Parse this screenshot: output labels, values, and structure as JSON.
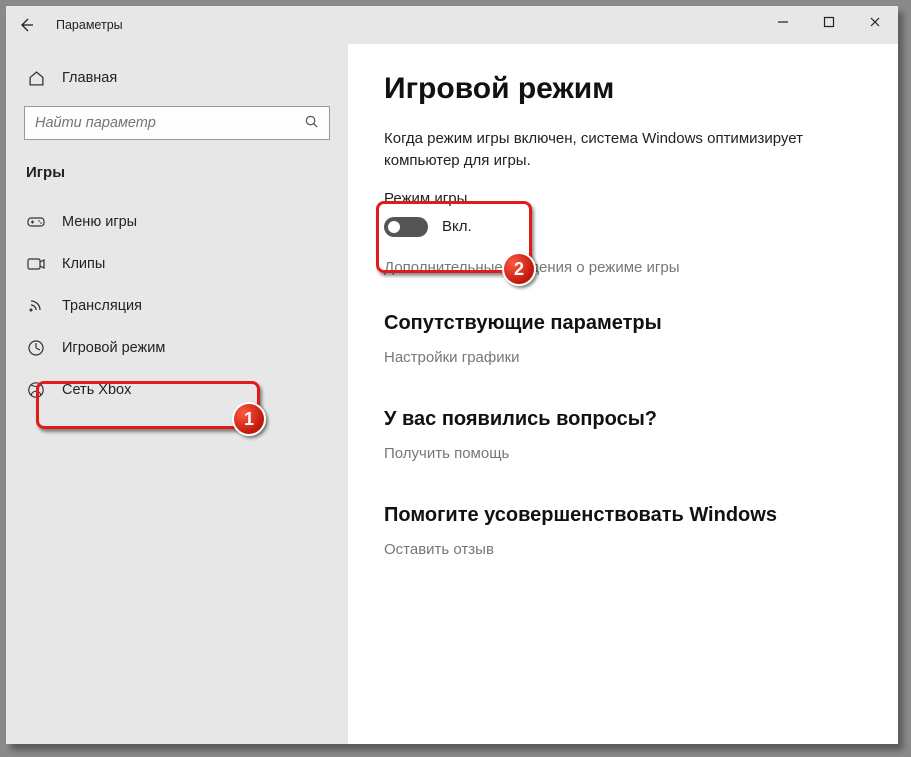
{
  "window": {
    "title": "Параметры"
  },
  "sidebar": {
    "home": "Главная",
    "search_placeholder": "Найти параметр",
    "category": "Игры",
    "items": [
      {
        "label": "Меню игры"
      },
      {
        "label": "Клипы"
      },
      {
        "label": "Трансляция"
      },
      {
        "label": "Игровой режим"
      },
      {
        "label": "Сеть Xbox"
      }
    ]
  },
  "content": {
    "title": "Игровой режим",
    "description": "Когда режим игры включен, система Windows оптимизирует компьютер для игры.",
    "toggle_label": "Режим игры",
    "toggle_state": "Вкл.",
    "more_info": "Дополнительные сведения о режиме игры",
    "related_heading": "Сопутствующие параметры",
    "related_link": "Настройки графики",
    "help_heading": "У вас появились вопросы?",
    "help_link": "Получить помощь",
    "feedback_heading": "Помогите усовершенствовать Windows",
    "feedback_link": "Оставить отзыв"
  },
  "annotations": {
    "badge1": "1",
    "badge2": "2"
  }
}
